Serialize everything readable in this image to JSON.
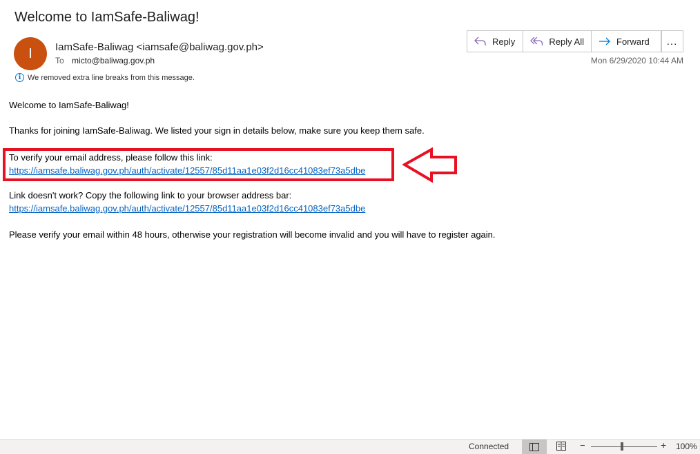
{
  "message": {
    "subject": "Welcome to IamSafe-Baliwag!",
    "avatar_initial": "I",
    "sender": "IamSafe-Baliwag <iamsafe@baliwag.gov.ph>",
    "to_label": "To",
    "to_address": "micto@baliwag.gov.ph",
    "info_text": "We removed extra line breaks from this message.",
    "timestamp": "Mon 6/29/2020 10:44 AM"
  },
  "actions": {
    "reply": "Reply",
    "reply_all": "Reply All",
    "forward": "Forward",
    "more": "..."
  },
  "body": {
    "greeting": "Welcome to IamSafe-Baliwag!",
    "thanks": "Thanks for joining IamSafe-Baliwag. We listed your sign in details below, make sure you keep them safe.",
    "verify_prompt": "To verify your email address, please follow this link:",
    "verify_link": "https://iamsafe.baliwag.gov.ph/auth/activate/12557/85d11aa1e03f2d16cc41083ef73a5dbe",
    "fallback_prompt": "Link doesn't work? Copy the following link to your browser address bar:",
    "fallback_link": "https://iamsafe.baliwag.gov.ph/auth/activate/12557/85d11aa1e03f2d16cc41083ef73a5dbe",
    "expiry_notice": "Please verify your email within 48 hours, otherwise your registration will become invalid and you will have to register again."
  },
  "status": {
    "connection": "Connected",
    "zoom_minus": "−",
    "zoom_plus": "+",
    "zoom_level": "100%",
    "zoom_fraction": 0.47
  },
  "colors": {
    "avatar": "#ca5010",
    "link": "#0563c1",
    "highlight": "#e81123",
    "action_icon": "#8764b8",
    "forward_icon": "#0078d4"
  }
}
